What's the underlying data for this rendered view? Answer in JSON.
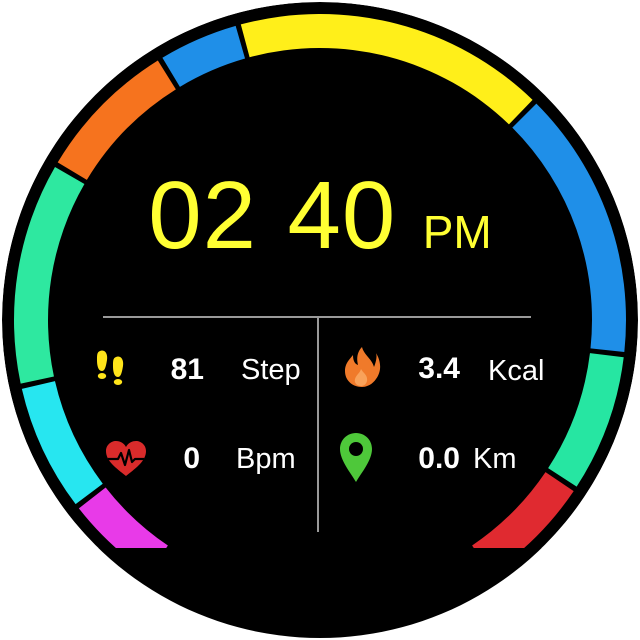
{
  "time": {
    "hours": "02",
    "minutes": "40",
    "ampm": "PM"
  },
  "stats": {
    "steps": {
      "value": "81",
      "unit": "Step",
      "icon": "footsteps-icon",
      "color": "#ffe41a"
    },
    "calories": {
      "value": "3.4",
      "unit": "Kcal",
      "icon": "flame-icon",
      "color": "#f07a2a"
    },
    "heart_rate": {
      "value": "0",
      "unit": "Bpm",
      "icon": "heart-rate-icon",
      "color": "#d92b2b"
    },
    "distance": {
      "value": "0.0",
      "unit": "Km",
      "icon": "location-pin-icon",
      "color": "#4ec83a"
    }
  },
  "ring_colors": {
    "yellow": "#ffef1a",
    "blue": "#1f8fe8",
    "teal": "#26e6a2",
    "red": "#e02a30",
    "magenta": "#e83ae8",
    "cyan": "#27e6f0",
    "green": "#2ee8a0",
    "orange": "#f6731e"
  },
  "colors": {
    "time": "#ffff33",
    "face": "#000000",
    "divider": "#9a9a9a"
  }
}
